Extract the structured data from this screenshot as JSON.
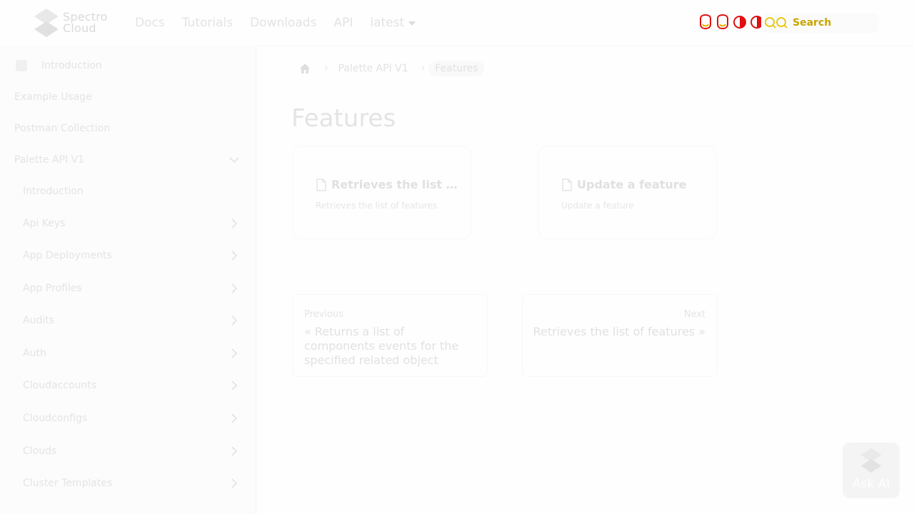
{
  "brand": {
    "line1": "Spectro",
    "line2": "Cloud"
  },
  "nav": {
    "links": [
      "Docs",
      "Tutorials",
      "Downloads",
      "API"
    ],
    "version": "latest",
    "search_label": "Search"
  },
  "sidebar": {
    "top_items": [
      "Introduction",
      "Example Usage",
      "Postman Collection",
      "Palette API V1"
    ],
    "sub_items": [
      "Introduction",
      "Api Keys",
      "App Deployments",
      "App Profiles",
      "Audits",
      "Auth",
      "Cloudaccounts",
      "Cloudconfigs",
      "Clouds",
      "Cluster Templates"
    ]
  },
  "breadcrumb": {
    "parent": "Palette API V1",
    "current": "Features"
  },
  "page": {
    "title": "Features"
  },
  "cards": [
    {
      "title": "Retrieves the list of features",
      "description": "Retrieves the list of features"
    },
    {
      "title": "Update a feature",
      "description": "Update a feature"
    }
  ],
  "pagination": {
    "previous": {
      "label": "Previous",
      "title": "« Returns a list of components events for the specified related object"
    },
    "next": {
      "label": "Next",
      "title": "Retrieves the list of features »"
    }
  },
  "ask_ai": {
    "label": "Ask AI"
  }
}
